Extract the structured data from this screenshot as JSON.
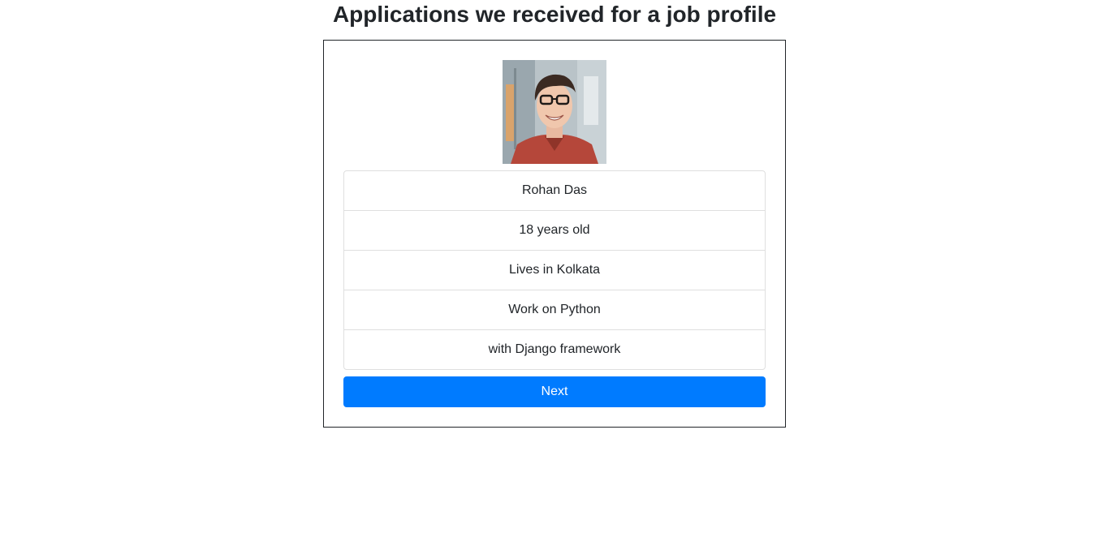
{
  "page": {
    "title": "Applications we received for a job profile"
  },
  "profile": {
    "photo_alt": "Applicant photo",
    "items": [
      "Rohan Das",
      "18 years old",
      "Lives in Kolkata",
      "Work on Python",
      "with Django framework"
    ]
  },
  "actions": {
    "next_label": "Next"
  },
  "colors": {
    "primary": "#007bff",
    "text": "#212529",
    "border": "#dfdfdf"
  }
}
